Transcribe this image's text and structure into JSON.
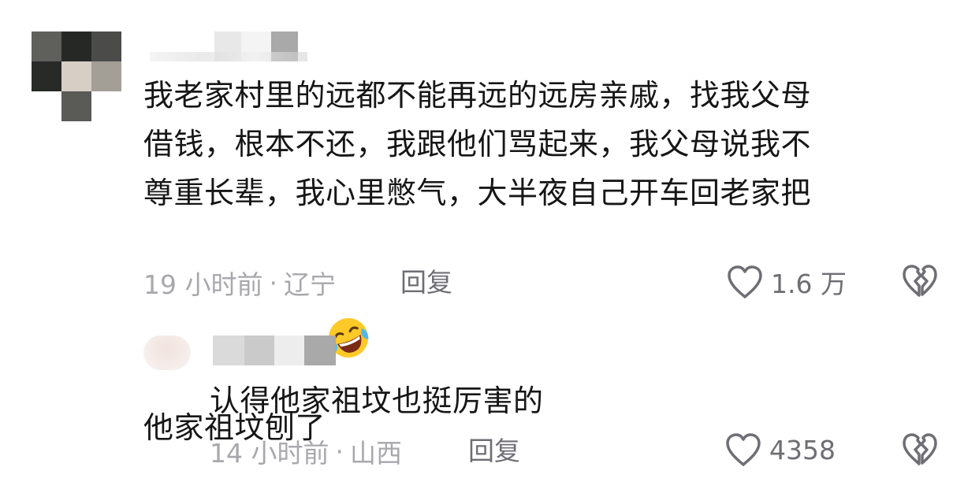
{
  "comments": [
    {
      "text_lines": [
        "我老家村里的远都不能再远的远房亲戚，找我父母",
        "借钱，根本不还，我跟他们骂起来，我父母说我不",
        "尊重长辈，我心里憋气，大半夜自己开车回老家把",
        "他家祖坟刨了"
      ],
      "emoji": "rolling-on-floor-laughing-emoji",
      "time": "19 小时前",
      "location": "辽宁",
      "reply_label": "回复",
      "likes": "1.6 万"
    }
  ],
  "replies": [
    {
      "text": "认得他家祖坟也挺厉害的",
      "time": "14 小时前",
      "location": "山西",
      "reply_label": "回复",
      "likes": "4358"
    }
  ],
  "separator": "·",
  "colors": {
    "text": "#161616",
    "meta": "#a8a8ad",
    "action": "#6e6e74",
    "icon": "#6e6e74"
  },
  "icons": {
    "like": "heart-outline-icon",
    "dislike": "broken-heart-icon"
  }
}
